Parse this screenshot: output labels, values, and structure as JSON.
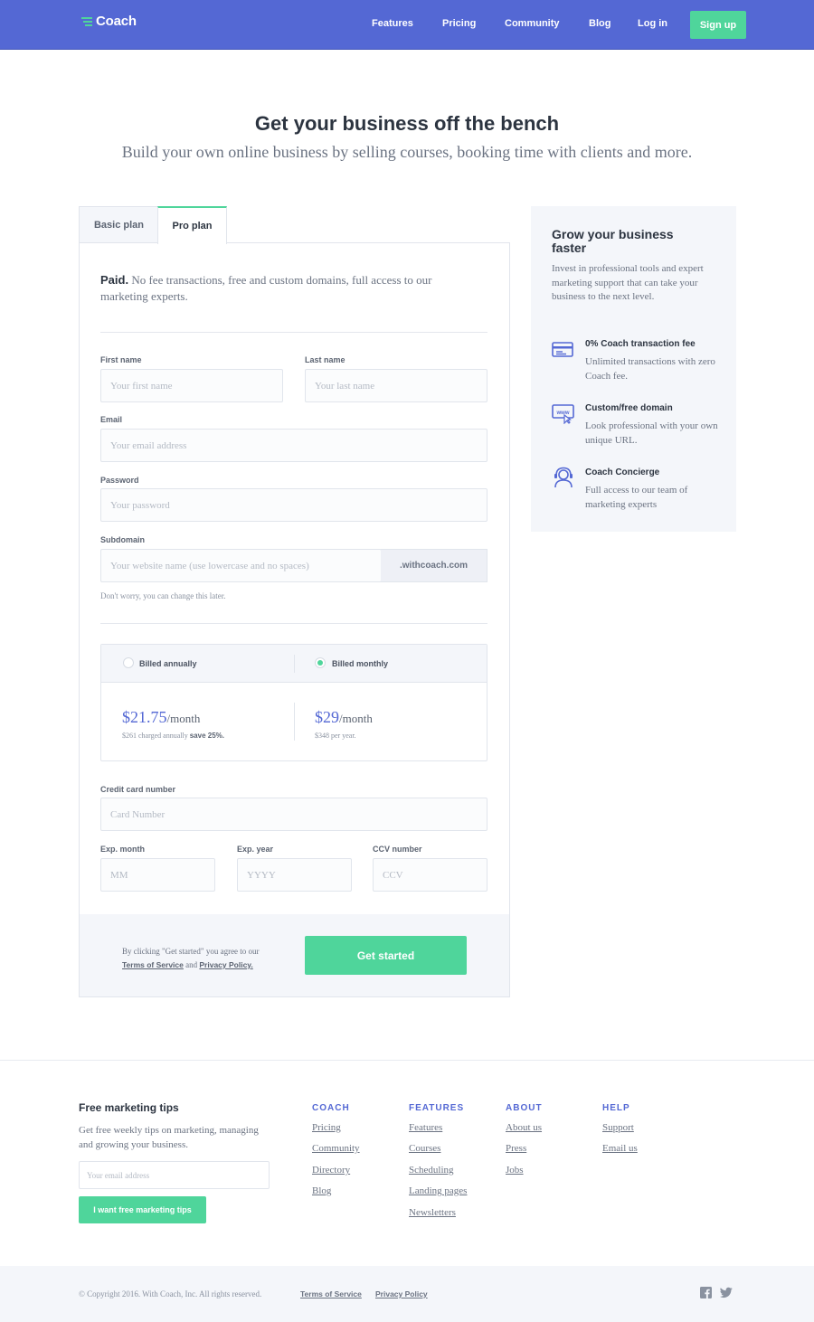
{
  "nav": {
    "logo": "Coach",
    "links": [
      "Features",
      "Pricing",
      "Community",
      "Blog",
      "Log in"
    ],
    "signup": "Sign up"
  },
  "hero": {
    "title": "Get your business off the bench",
    "subtitle": "Build your own online business by selling courses, booking time with clients and more."
  },
  "tabs": {
    "basic": "Basic plan",
    "pro": "Pro plan",
    "active": "pro"
  },
  "form": {
    "intro_bold": "Paid.",
    "intro_text": " No fee transactions, free and custom domains, full access to our marketing experts.",
    "first_name": {
      "label": "First name",
      "placeholder": "Your first name"
    },
    "last_name": {
      "label": "Last name",
      "placeholder": "Your last name"
    },
    "email": {
      "label": "Email",
      "placeholder": "Your email address"
    },
    "password": {
      "label": "Password",
      "placeholder": "Your password"
    },
    "subdomain": {
      "label": "Subdomain",
      "placeholder": "Your website name (use lowercase and no spaces)",
      "suffix": ".withcoach.com",
      "hint": "Don't worry, you can change this later."
    },
    "billing": {
      "annual_label": "Billed annually",
      "monthly_label": "Billed monthly",
      "selected": "monthly",
      "annual_price": "$21.75",
      "annual_per": "/month",
      "annual_note": "$261 charged annually ",
      "annual_save": "save 25%.",
      "monthly_price": "$29",
      "monthly_per": "/month",
      "monthly_note": "$348 per year."
    },
    "card_number": {
      "label": "Credit card number",
      "placeholder": "Card Number"
    },
    "exp_month": {
      "label": "Exp. month",
      "placeholder": "MM"
    },
    "exp_year": {
      "label": "Exp. year",
      "placeholder": "YYYY"
    },
    "ccv": {
      "label": "CCV number",
      "placeholder": "CCV"
    },
    "agree_text": "By clicking \"Get started\" you agree to our",
    "terms": "Terms of Service",
    "and": " and ",
    "privacy": "Privacy Policy.",
    "cta": "Get started"
  },
  "aside": {
    "title": "Grow your business faster",
    "text": "Invest in professional tools and expert marketing support that can take your business to the next level.",
    "features": [
      {
        "icon": "credit-card-icon",
        "title": "0% Coach transaction fee",
        "text": "Unlimited transactions with zero Coach fee."
      },
      {
        "icon": "www-domain-icon",
        "title": "Custom/free domain",
        "text": "Look professional with your own unique URL."
      },
      {
        "icon": "headset-icon",
        "title": "Coach Concierge",
        "text": "Full access to our team of marketing experts"
      }
    ]
  },
  "footer": {
    "newsletter_title": "Free marketing tips",
    "newsletter_text": "Get free weekly tips on marketing, managing and growing your business.",
    "newsletter_placeholder": "Your email address",
    "newsletter_button": "I want free marketing tips",
    "columns": [
      {
        "heading": "COACH",
        "links": [
          "Pricing",
          "Community",
          "Directory",
          "Blog"
        ]
      },
      {
        "heading": "FEATURES",
        "links": [
          "Features",
          "Courses",
          "Scheduling",
          "Landing pages",
          "Newsletters"
        ]
      },
      {
        "heading": "ABOUT",
        "links": [
          "About us",
          "Press",
          "Jobs"
        ]
      },
      {
        "heading": "HELP",
        "links": [
          "Support",
          "Email us"
        ]
      }
    ],
    "copyright": "© Copyright 2016. With Coach, Inc. All rights reserved.",
    "terms": "Terms of Service",
    "privacy": "Privacy Policy",
    "social": [
      "facebook-icon",
      "twitter-icon"
    ]
  },
  "colors": {
    "brand": "#5468d4",
    "accent": "#4fd59b",
    "panel": "#f4f6fa"
  }
}
